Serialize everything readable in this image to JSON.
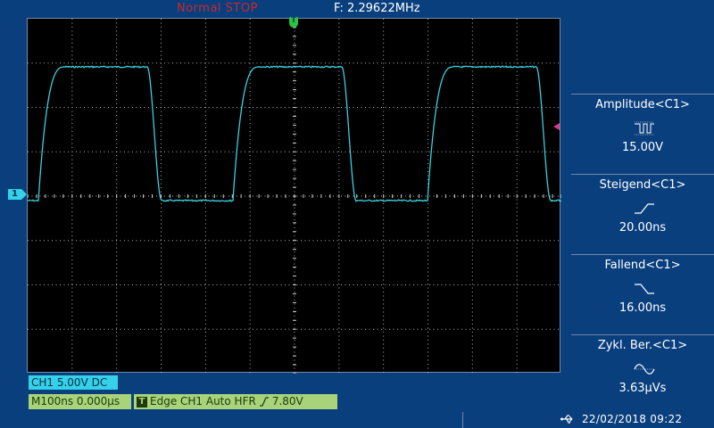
{
  "header": {
    "status": "Normal STOP",
    "frequency": "F: 2.29622MHz",
    "trigger_marker": "T"
  },
  "channel_marker": "1",
  "measurements": [
    {
      "label": "Amplitude<C1>",
      "value": "15.00V",
      "icon": "pulse-icon"
    },
    {
      "label": "Steigend<C1>",
      "value": "20.00ns",
      "icon": "rising-edge-icon"
    },
    {
      "label": "Fallend<C1>",
      "value": "16.00ns",
      "icon": "falling-edge-icon"
    },
    {
      "label": "Zykl. Ber.<C1>",
      "value": "3.63µVs",
      "icon": "sine-area-icon"
    }
  ],
  "footer": {
    "channel_info": "CH1  5.00V  DC",
    "timebase": "M100ns  0.000µs",
    "trigger_badge": "T",
    "trigger_info": "Edge  CH1  Auto  HFR",
    "trigger_level": "7.80V",
    "datetime": "22/02/2018  09:22"
  },
  "colors": {
    "trace": "#3ad0e0",
    "grid": "#cfcfcf",
    "background": "#0a3f7e",
    "status": "#c8282d"
  }
}
